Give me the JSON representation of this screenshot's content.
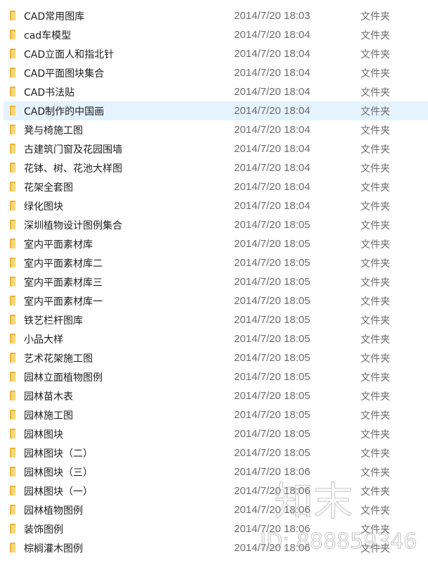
{
  "type_label": "文件夹",
  "selected_index": 5,
  "colors": {
    "selected_row": "#e5f3ff",
    "folder": "#f8d775"
  },
  "watermark": {
    "brand": "知末",
    "id": "ID: 888859346"
  },
  "files": [
    {
      "name": "CAD常用图库",
      "date": "2014/7/20 18:03"
    },
    {
      "name": "cad车模型",
      "date": "2014/7/20 18:04"
    },
    {
      "name": "CAD立面人和指北针",
      "date": "2014/7/20 18:04"
    },
    {
      "name": "CAD平面图块集合",
      "date": "2014/7/20 18:04"
    },
    {
      "name": "CAD书法贴",
      "date": "2014/7/20 18:04"
    },
    {
      "name": "CAD制作的中国画",
      "date": "2014/7/20 18:04"
    },
    {
      "name": "凳与椅施工图",
      "date": "2014/7/20 18:04"
    },
    {
      "name": "古建筑门窗及花园围墙",
      "date": "2014/7/20 18:04"
    },
    {
      "name": "花钵、树、花池大样图",
      "date": "2014/7/20 18:04"
    },
    {
      "name": "花架全套图",
      "date": "2014/7/20 18:04"
    },
    {
      "name": "绿化图块",
      "date": "2014/7/20 18:04"
    },
    {
      "name": "深圳植物设计图例集合",
      "date": "2014/7/20 18:05"
    },
    {
      "name": "室内平面素材库",
      "date": "2014/7/20 18:05"
    },
    {
      "name": "室内平面素材库二",
      "date": "2014/7/20 18:05"
    },
    {
      "name": "室内平面素材库三",
      "date": "2014/7/20 18:05"
    },
    {
      "name": "室内平面素材库一",
      "date": "2014/7/20 18:05"
    },
    {
      "name": "铁艺栏杆图库",
      "date": "2014/7/20 18:05"
    },
    {
      "name": "小品大样",
      "date": "2014/7/20 18:05"
    },
    {
      "name": "艺术花架施工图",
      "date": "2014/7/20 18:05"
    },
    {
      "name": "园林立面植物图例",
      "date": "2014/7/20 18:05"
    },
    {
      "name": "园林苗木表",
      "date": "2014/7/20 18:05"
    },
    {
      "name": "园林施工图",
      "date": "2014/7/20 18:05"
    },
    {
      "name": "园林图块",
      "date": "2014/7/20 18:05"
    },
    {
      "name": "园林图块（二）",
      "date": "2014/7/20 18:05"
    },
    {
      "name": "园林图块（三）",
      "date": "2014/7/20 18:06"
    },
    {
      "name": "园林图块（一）",
      "date": "2014/7/20 18:06"
    },
    {
      "name": "园林植物图例",
      "date": "2014/7/20 18:06"
    },
    {
      "name": "装饰图例",
      "date": "2014/7/20 18:06"
    },
    {
      "name": "棕榈灌木图例",
      "date": "2014/7/20 18:06"
    }
  ]
}
